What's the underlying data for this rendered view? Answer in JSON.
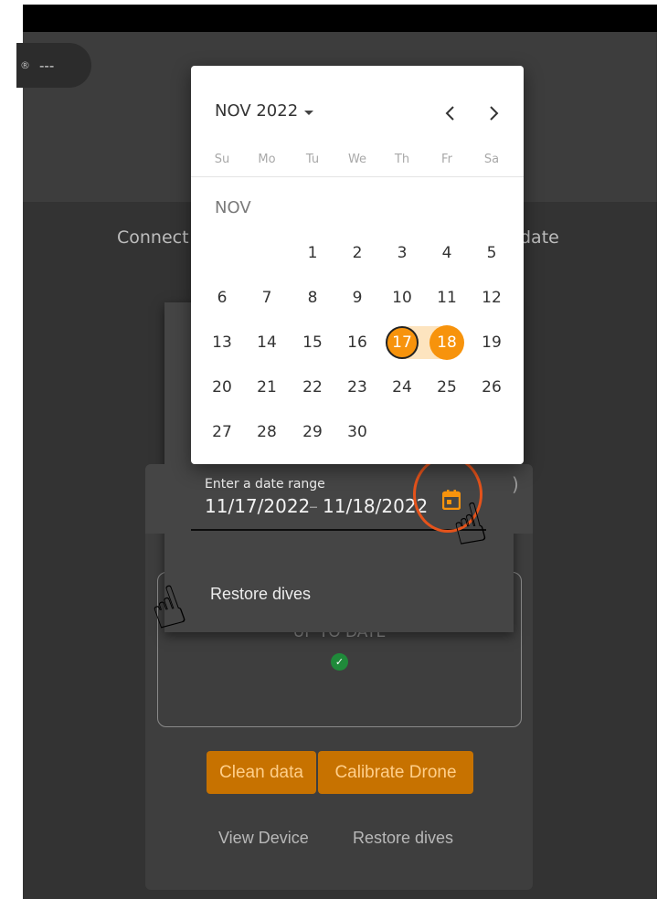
{
  "status_pill": {
    "icon": "bluetooth-icon",
    "text": "---"
  },
  "background": {
    "connect_label": "Connect",
    "update_label": "date",
    "status": "UP TO DATE",
    "buttons": {
      "clean": "Clean data",
      "calibrate": "Calibrate Drone"
    },
    "links": {
      "view_device": "View Device",
      "restore": "Restore dives"
    }
  },
  "range_field": {
    "label": "Enter a date range",
    "start": "11/17/2022",
    "separator": "–",
    "end": "11/18/2022",
    "toggle_icon": "calendar-icon",
    "trailing": ")"
  },
  "menu": {
    "restore_label": "Restore dives"
  },
  "calendar": {
    "month_year": "NOV 2022",
    "month_label": "NOV",
    "weekdays": [
      "Su",
      "Mo",
      "Tu",
      "We",
      "Th",
      "Fr",
      "Sa"
    ],
    "weeks": [
      [
        "",
        "",
        "1",
        "2",
        "3",
        "4",
        "5"
      ],
      [
        "6",
        "7",
        "8",
        "9",
        "10",
        "11",
        "12"
      ],
      [
        "13",
        "14",
        "15",
        "16",
        "17",
        "18",
        "19"
      ],
      [
        "20",
        "21",
        "22",
        "23",
        "24",
        "25",
        "26"
      ],
      [
        "27",
        "28",
        "29",
        "30",
        "",
        "",
        ""
      ]
    ],
    "selected_start": "17",
    "selected_end": "18",
    "prev_icon": "chevron-left-icon",
    "next_icon": "chevron-right-icon"
  },
  "colors": {
    "accent": "#f7930c",
    "hint_ring": "#e5531b",
    "button": "#c77200"
  }
}
